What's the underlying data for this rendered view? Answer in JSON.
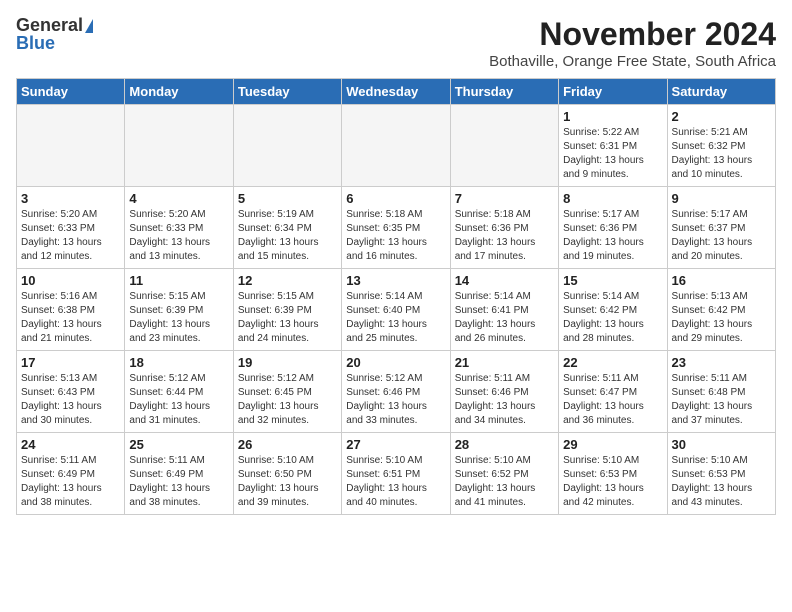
{
  "header": {
    "logo_general": "General",
    "logo_blue": "Blue",
    "month_title": "November 2024",
    "subtitle": "Bothaville, Orange Free State, South Africa"
  },
  "days_of_week": [
    "Sunday",
    "Monday",
    "Tuesday",
    "Wednesday",
    "Thursday",
    "Friday",
    "Saturday"
  ],
  "weeks": [
    [
      {
        "day": "",
        "info": ""
      },
      {
        "day": "",
        "info": ""
      },
      {
        "day": "",
        "info": ""
      },
      {
        "day": "",
        "info": ""
      },
      {
        "day": "",
        "info": ""
      },
      {
        "day": "1",
        "info": "Sunrise: 5:22 AM\nSunset: 6:31 PM\nDaylight: 13 hours and 9 minutes."
      },
      {
        "day": "2",
        "info": "Sunrise: 5:21 AM\nSunset: 6:32 PM\nDaylight: 13 hours and 10 minutes."
      }
    ],
    [
      {
        "day": "3",
        "info": "Sunrise: 5:20 AM\nSunset: 6:33 PM\nDaylight: 13 hours and 12 minutes."
      },
      {
        "day": "4",
        "info": "Sunrise: 5:20 AM\nSunset: 6:33 PM\nDaylight: 13 hours and 13 minutes."
      },
      {
        "day": "5",
        "info": "Sunrise: 5:19 AM\nSunset: 6:34 PM\nDaylight: 13 hours and 15 minutes."
      },
      {
        "day": "6",
        "info": "Sunrise: 5:18 AM\nSunset: 6:35 PM\nDaylight: 13 hours and 16 minutes."
      },
      {
        "day": "7",
        "info": "Sunrise: 5:18 AM\nSunset: 6:36 PM\nDaylight: 13 hours and 17 minutes."
      },
      {
        "day": "8",
        "info": "Sunrise: 5:17 AM\nSunset: 6:36 PM\nDaylight: 13 hours and 19 minutes."
      },
      {
        "day": "9",
        "info": "Sunrise: 5:17 AM\nSunset: 6:37 PM\nDaylight: 13 hours and 20 minutes."
      }
    ],
    [
      {
        "day": "10",
        "info": "Sunrise: 5:16 AM\nSunset: 6:38 PM\nDaylight: 13 hours and 21 minutes."
      },
      {
        "day": "11",
        "info": "Sunrise: 5:15 AM\nSunset: 6:39 PM\nDaylight: 13 hours and 23 minutes."
      },
      {
        "day": "12",
        "info": "Sunrise: 5:15 AM\nSunset: 6:39 PM\nDaylight: 13 hours and 24 minutes."
      },
      {
        "day": "13",
        "info": "Sunrise: 5:14 AM\nSunset: 6:40 PM\nDaylight: 13 hours and 25 minutes."
      },
      {
        "day": "14",
        "info": "Sunrise: 5:14 AM\nSunset: 6:41 PM\nDaylight: 13 hours and 26 minutes."
      },
      {
        "day": "15",
        "info": "Sunrise: 5:14 AM\nSunset: 6:42 PM\nDaylight: 13 hours and 28 minutes."
      },
      {
        "day": "16",
        "info": "Sunrise: 5:13 AM\nSunset: 6:42 PM\nDaylight: 13 hours and 29 minutes."
      }
    ],
    [
      {
        "day": "17",
        "info": "Sunrise: 5:13 AM\nSunset: 6:43 PM\nDaylight: 13 hours and 30 minutes."
      },
      {
        "day": "18",
        "info": "Sunrise: 5:12 AM\nSunset: 6:44 PM\nDaylight: 13 hours and 31 minutes."
      },
      {
        "day": "19",
        "info": "Sunrise: 5:12 AM\nSunset: 6:45 PM\nDaylight: 13 hours and 32 minutes."
      },
      {
        "day": "20",
        "info": "Sunrise: 5:12 AM\nSunset: 6:46 PM\nDaylight: 13 hours and 33 minutes."
      },
      {
        "day": "21",
        "info": "Sunrise: 5:11 AM\nSunset: 6:46 PM\nDaylight: 13 hours and 34 minutes."
      },
      {
        "day": "22",
        "info": "Sunrise: 5:11 AM\nSunset: 6:47 PM\nDaylight: 13 hours and 36 minutes."
      },
      {
        "day": "23",
        "info": "Sunrise: 5:11 AM\nSunset: 6:48 PM\nDaylight: 13 hours and 37 minutes."
      }
    ],
    [
      {
        "day": "24",
        "info": "Sunrise: 5:11 AM\nSunset: 6:49 PM\nDaylight: 13 hours and 38 minutes."
      },
      {
        "day": "25",
        "info": "Sunrise: 5:11 AM\nSunset: 6:49 PM\nDaylight: 13 hours and 38 minutes."
      },
      {
        "day": "26",
        "info": "Sunrise: 5:10 AM\nSunset: 6:50 PM\nDaylight: 13 hours and 39 minutes."
      },
      {
        "day": "27",
        "info": "Sunrise: 5:10 AM\nSunset: 6:51 PM\nDaylight: 13 hours and 40 minutes."
      },
      {
        "day": "28",
        "info": "Sunrise: 5:10 AM\nSunset: 6:52 PM\nDaylight: 13 hours and 41 minutes."
      },
      {
        "day": "29",
        "info": "Sunrise: 5:10 AM\nSunset: 6:53 PM\nDaylight: 13 hours and 42 minutes."
      },
      {
        "day": "30",
        "info": "Sunrise: 5:10 AM\nSunset: 6:53 PM\nDaylight: 13 hours and 43 minutes."
      }
    ]
  ]
}
